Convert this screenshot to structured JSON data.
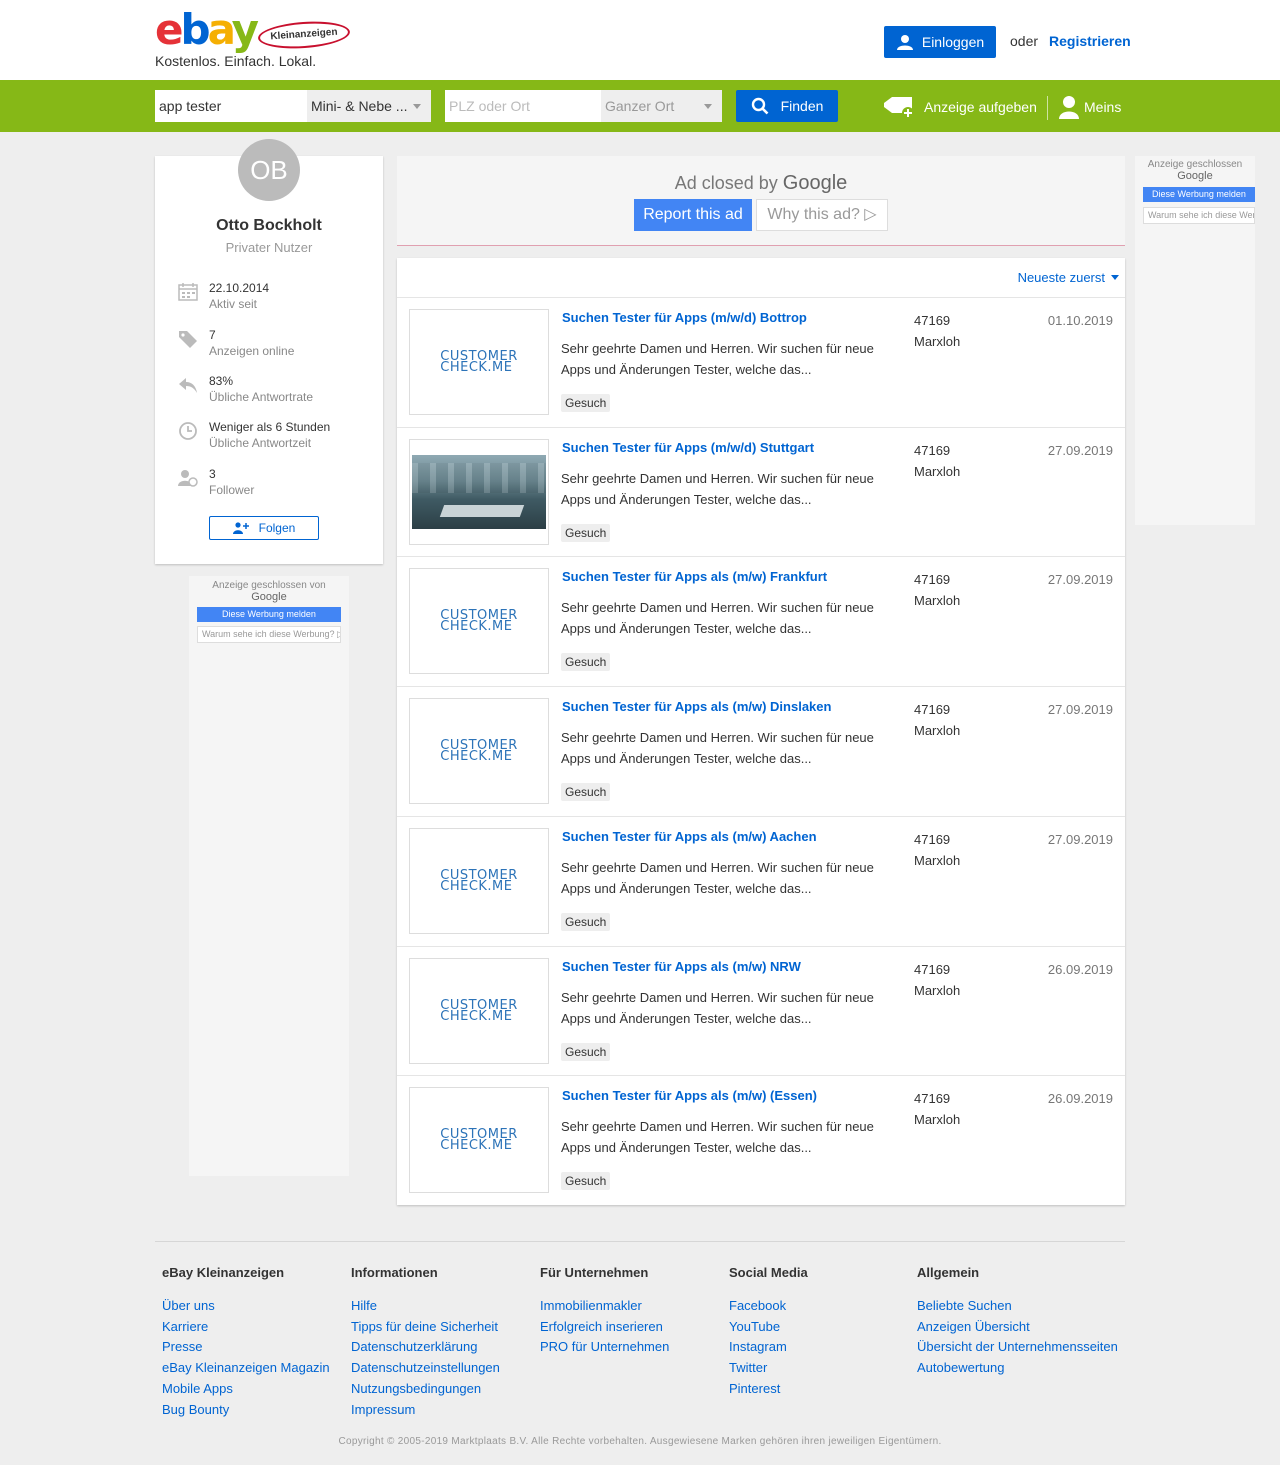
{
  "header": {
    "logo_letters": [
      "e",
      "b",
      "a",
      "y"
    ],
    "logo_badge": "Kleinanzeigen",
    "tagline": "Kostenlos. Einfach. Lokal.",
    "login_label": "Einloggen",
    "or_label": "oder",
    "register_label": "Registrieren"
  },
  "search": {
    "query": "app tester",
    "category": "Mini- & Nebe ...",
    "location_placeholder": "PLZ oder Ort",
    "radius": "Ganzer Ort",
    "find_label": "Finden",
    "post_ad_label": "Anzeige aufgeben",
    "account_label": "Meins"
  },
  "profile": {
    "initials": "OB",
    "name": "Otto Bockholt",
    "type": "Privater Nutzer",
    "stats": [
      {
        "icon": "calendar-icon",
        "value": "22.10.2014",
        "label": "Aktiv seit"
      },
      {
        "icon": "tag-icon",
        "value": "7",
        "label": "Anzeigen online"
      },
      {
        "icon": "reply-icon",
        "value": "83%",
        "label": "Übliche Antwortrate"
      },
      {
        "icon": "clock-icon",
        "value": "Weniger als 6 Stunden",
        "label": "Übliche Antwortzeit"
      },
      {
        "icon": "follower-icon",
        "value": "3",
        "label": "Follower"
      }
    ],
    "follow_label": "Folgen"
  },
  "ads": {
    "left_closed": "Anzeige geschlossen von",
    "google": "Google",
    "report_small": "Diese Werbung melden",
    "why_small": "Warum sehe ich diese Werbung? ▷",
    "right_closed": "Anzeige geschlossen",
    "right_why": "Warum sehe ich diese Werbung?",
    "top_closed": "Ad closed by",
    "top_report": "Report this ad",
    "top_why": "Why this ad? ▷"
  },
  "listing": {
    "sort_label": "Neueste zuerst",
    "items": [
      {
        "title": "Suchen Tester für Apps (m/w/d) Bottrop",
        "desc": "Sehr geehrte Damen und Herren. Wir suchen für neue Apps und Änderungen Tester, welche das...",
        "tag": "Gesuch",
        "zip": "47169",
        "city": "Marxloh",
        "date": "01.10.2019",
        "image": "logo"
      },
      {
        "title": "Suchen Tester für Apps (m/w/d) Stuttgart",
        "desc": "Sehr geehrte Damen und Herren. Wir suchen für neue Apps und Änderungen Tester, welche das...",
        "tag": "Gesuch",
        "zip": "47169",
        "city": "Marxloh",
        "date": "27.09.2019",
        "image": "photo"
      },
      {
        "title": "Suchen Tester für Apps als (m/w) Frankfurt",
        "desc": "Sehr geehrte Damen und Herren. Wir suchen für neue Apps und Änderungen Tester, welche das...",
        "tag": "Gesuch",
        "zip": "47169",
        "city": "Marxloh",
        "date": "27.09.2019",
        "image": "logo"
      },
      {
        "title": "Suchen Tester für Apps als (m/w) Dinslaken",
        "desc": "Sehr geehrte Damen und Herren. Wir suchen für neue Apps und Änderungen Tester, welche das...",
        "tag": "Gesuch",
        "zip": "47169",
        "city": "Marxloh",
        "date": "27.09.2019",
        "image": "logo"
      },
      {
        "title": "Suchen Tester für Apps als (m/w) Aachen",
        "desc": "Sehr geehrte Damen und Herren. Wir suchen für neue Apps und Änderungen Tester, welche das...",
        "tag": "Gesuch",
        "zip": "47169",
        "city": "Marxloh",
        "date": "27.09.2019",
        "image": "logo"
      },
      {
        "title": "Suchen Tester für Apps als (m/w) NRW",
        "desc": "Sehr geehrte Damen und Herren. Wir suchen für neue Apps und Änderungen Tester, welche das...",
        "tag": "Gesuch",
        "zip": "47169",
        "city": "Marxloh",
        "date": "26.09.2019",
        "image": "logo"
      },
      {
        "title": "Suchen Tester für Apps als (m/w) (Essen)",
        "desc": "Sehr geehrte Damen und Herren. Wir suchen für neue Apps und Änderungen Tester, welche das...",
        "tag": "Gesuch",
        "zip": "47169",
        "city": "Marxloh",
        "date": "26.09.2019",
        "image": "logo"
      }
    ],
    "logo_text": [
      "CUSTOMER",
      "CHECK.ME"
    ]
  },
  "footer": {
    "columns": [
      {
        "title": "eBay Kleinanzeigen",
        "links": [
          "Über uns",
          "Karriere",
          "Presse",
          "eBay Kleinanzeigen Magazin",
          "Mobile Apps",
          "Bug Bounty"
        ]
      },
      {
        "title": "Informationen",
        "links": [
          "Hilfe",
          "Tipps für deine Sicherheit",
          "Datenschutzerklärung",
          "Datenschutzeinstellungen",
          "Nutzungsbedingungen",
          "Impressum"
        ]
      },
      {
        "title": "Für Unternehmen",
        "links": [
          "Immobilienmakler",
          "Erfolgreich inserieren",
          "PRO für Unternehmen"
        ]
      },
      {
        "title": "Social Media",
        "links": [
          "Facebook",
          "YouTube",
          "Instagram",
          "Twitter",
          "Pinterest"
        ]
      },
      {
        "title": "Allgemein",
        "links": [
          "Beliebte Suchen",
          "Anzeigen Übersicht",
          "Übersicht der Unternehmensseiten",
          "Autobewertung"
        ]
      }
    ],
    "copyright": "Copyright © 2005-2019 Marktplaats B.V. Alle Rechte vorbehalten. Ausgewiesene Marken gehören ihren jeweiligen Eigentümern."
  },
  "colors": {
    "brand_green": "#86b817",
    "link_blue": "#0064d2",
    "google_blue": "#4285f4"
  }
}
